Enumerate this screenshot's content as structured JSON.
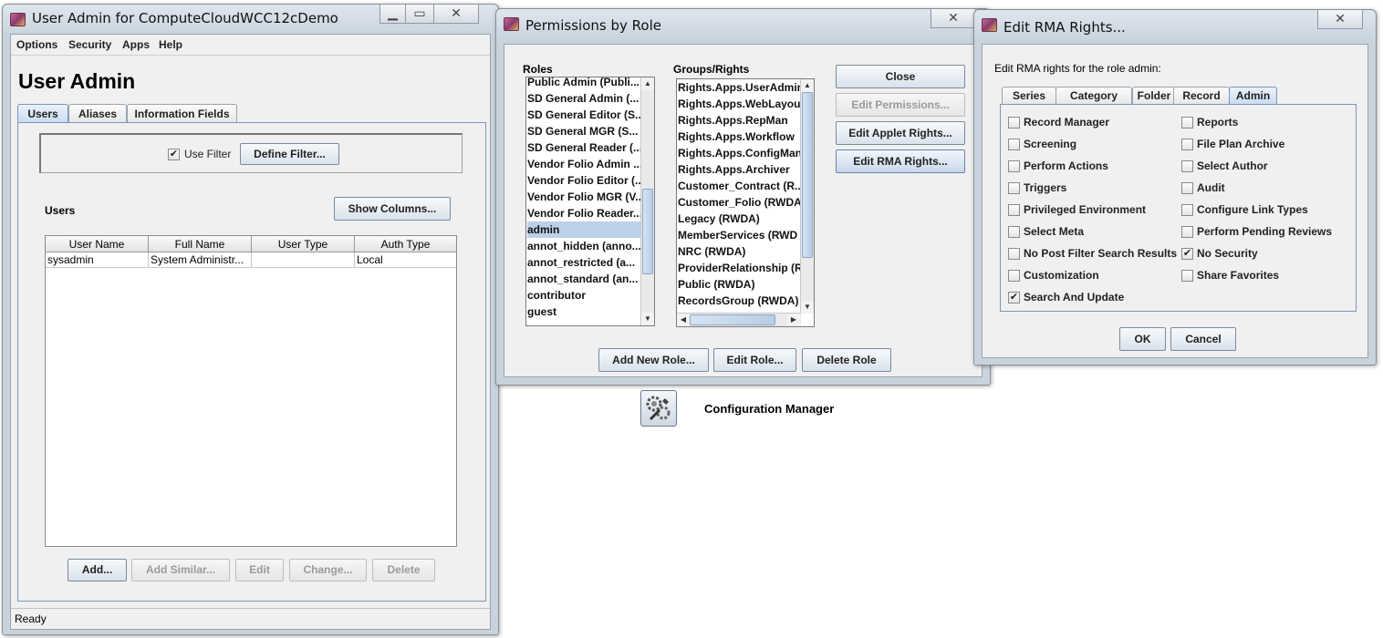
{
  "user_admin_window": {
    "title": "User Admin for ComputeCloudWCC12cDemo",
    "menu": [
      "Options",
      "Security",
      "Apps",
      "Help"
    ],
    "heading": "User Admin",
    "tabs": [
      "Users",
      "Aliases",
      "Information Fields"
    ],
    "active_tab": "Users",
    "use_filter_label": "Use Filter",
    "use_filter_checked": true,
    "define_filter_button": "Define Filter...",
    "users_label": "Users",
    "show_columns_button": "Show Columns...",
    "table_columns": [
      "User Name",
      "Full Name",
      "User Type",
      "Auth Type"
    ],
    "table_rows": [
      [
        "sysadmin",
        "System Administr...",
        "",
        "Local"
      ]
    ],
    "buttons": {
      "add": "Add...",
      "add_similar": "Add Similar...",
      "edit": "Edit",
      "change": "Change...",
      "delete": "Delete"
    },
    "status": "Ready"
  },
  "permissions_window": {
    "title": "Permissions by Role",
    "roles_label": "Roles",
    "roles": [
      "Public Admin (Publi...",
      "SD General Admin (...",
      "SD General Editor (S...",
      "SD General MGR (S...",
      "SD General Reader (...",
      "Vendor Folio Admin ...",
      "Vendor Folio Editor (...",
      "Vendor Folio MGR (V...",
      "Vendor Folio Reader...",
      "admin",
      "annot_hidden (anno...",
      "annot_restricted (a...",
      "annot_standard (an...",
      "contributor",
      "guest"
    ],
    "selected_role": "admin",
    "groups_label": "Groups/Rights",
    "groups": [
      "Rights.Apps.UserAdmin",
      "Rights.Apps.WebLayout",
      "Rights.Apps.RepMan",
      "Rights.Apps.Workflow",
      "Rights.Apps.ConfigMan",
      "Rights.Apps.Archiver",
      "Customer_Contract  (R...",
      "Customer_Folio  (RWDA",
      "Legacy  (RWDA)",
      "MemberServices  (RWD",
      "NRC  (RWDA)",
      "ProviderRelationship  (R",
      "Public  (RWDA)",
      "RecordsGroup  (RWDA)"
    ],
    "buttons": {
      "close": "Close",
      "edit_permissions": "Edit Permissions...",
      "edit_applet_rights": "Edit Applet Rights...",
      "edit_rma_rights": "Edit RMA Rights...",
      "add_new_role": "Add New Role...",
      "edit_role": "Edit Role...",
      "delete_role": "Delete Role"
    }
  },
  "rma_window": {
    "title": "Edit RMA Rights...",
    "instruction": "Edit RMA rights for the role admin:",
    "tabs": [
      "Series",
      "Category",
      "Folder",
      "Record",
      "Admin"
    ],
    "active_tab": "Admin",
    "left_options": [
      {
        "label": "Record Manager",
        "checked": false
      },
      {
        "label": "Screening",
        "checked": false
      },
      {
        "label": "Perform Actions",
        "checked": false
      },
      {
        "label": "Triggers",
        "checked": false
      },
      {
        "label": "Privileged Environment",
        "checked": false
      },
      {
        "label": "Select Meta",
        "checked": false
      },
      {
        "label": "No Post Filter Search Results",
        "checked": false
      },
      {
        "label": "Customization",
        "checked": false
      },
      {
        "label": "Search And Update",
        "checked": true
      }
    ],
    "right_options": [
      {
        "label": "Reports",
        "checked": false
      },
      {
        "label": "File Plan Archive",
        "checked": false
      },
      {
        "label": "Select Author",
        "checked": false
      },
      {
        "label": "Audit",
        "checked": false
      },
      {
        "label": "Configure Link Types",
        "checked": false
      },
      {
        "label": "Perform Pending Reviews",
        "checked": false
      },
      {
        "label": "No Security",
        "checked": true
      },
      {
        "label": "Share Favorites",
        "checked": false
      }
    ],
    "ok_button": "OK",
    "cancel_button": "Cancel"
  },
  "desktop_icon": {
    "label": "Configuration Manager",
    "icon": "tools-gear-icon"
  }
}
